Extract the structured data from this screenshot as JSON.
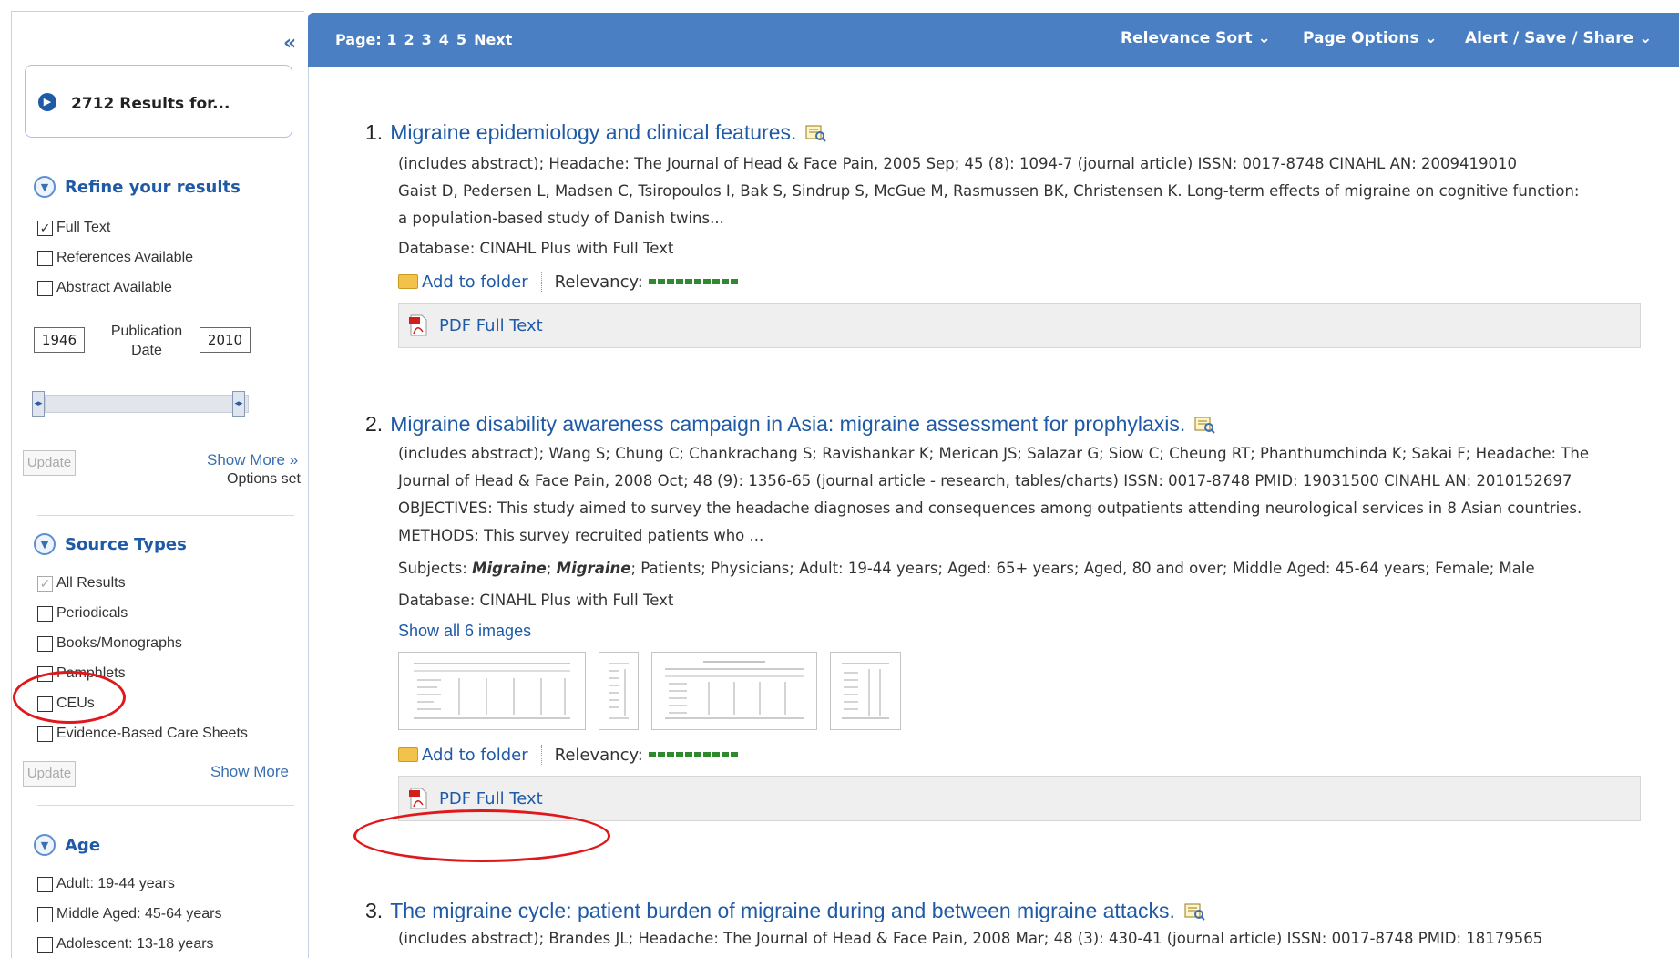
{
  "sidebar": {
    "collapse": "«",
    "results_count": "2712 Results for...",
    "refine_title": "Refine your results",
    "refine_options": [
      {
        "label": "Full Text",
        "checked": true
      },
      {
        "label": "References Available",
        "checked": false
      },
      {
        "label": "Abstract Available",
        "checked": false
      }
    ],
    "pub_from": "1946",
    "pub_to": "2010",
    "pub_label": "Publication Date",
    "update_label": "Update",
    "show_more_1": "Show More »",
    "options_set": "Options set",
    "source_types_title": "Source Types",
    "source_types": [
      {
        "label": "All Results",
        "checked": true,
        "disabled": true
      },
      {
        "label": "Periodicals",
        "checked": false
      },
      {
        "label": "Books/Monographs",
        "checked": false
      },
      {
        "label": "Pamphlets",
        "checked": false
      },
      {
        "label": "CEUs",
        "checked": false
      },
      {
        "label": "Evidence-Based Care Sheets",
        "checked": false
      }
    ],
    "show_more_2": "Show More",
    "age_title": "Age",
    "age_options": [
      {
        "label": "Adult: 19-44 years",
        "checked": false
      },
      {
        "label": "Middle Aged: 45-64 years",
        "checked": false
      },
      {
        "label": "Adolescent: 13-18 years",
        "checked": false
      }
    ]
  },
  "topbar": {
    "page_label": "Page: 1",
    "pages": [
      "2",
      "3",
      "4",
      "5"
    ],
    "next": "Next",
    "relevance_sort": "Relevance Sort ⌄",
    "page_options": "Page Options ⌄",
    "alert_save_share": "Alert / Save / Share ⌄"
  },
  "results": [
    {
      "num": "1.",
      "title": "Migraine epidemiology and clinical features.",
      "meta_line1": "(includes abstract); Headache: The Journal of Head & Face Pain, 2005 Sep; 45 (8): 1094-7 (journal article) ISSN: 0017-8748 CINAHL AN: 2009419010",
      "meta_line2": "Gaist D, Pedersen L, Madsen C, Tsiropoulos I, Bak S, Sindrup S, McGue M, Rasmussen BK, Christensen K. Long-term effects of migraine on cognitive function:",
      "meta_line3": "a population-based study of Danish twins...",
      "database": "Database: CINAHL Plus with Full Text",
      "add_to_folder": "Add to folder",
      "relevancy": "Relevancy:",
      "pdf": "PDF Full Text"
    },
    {
      "num": "2.",
      "title": "Migraine disability awareness campaign in Asia: migraine assessment for prophylaxis.",
      "meta_line1": "(includes abstract); Wang S; Chung C; Chankrachang S; Ravishankar K; Merican JS; Salazar G; Siow C; Cheung RT; Phanthumchinda K; Sakai F; Headache: The",
      "meta_line2": "Journal of Head & Face Pain, 2008 Oct; 48 (9): 1356-65 (journal article - research, tables/charts) ISSN: 0017-8748 PMID: 19031500 CINAHL AN: 2010152697",
      "meta_line3": "OBJECTIVES: This study aimed to survey the headache diagnoses and consequences among outpatients attending neurological services in 8 Asian countries.",
      "meta_line4": "METHODS: This survey recruited patients who ...",
      "subjects_label": "Subjects:",
      "subject_bold_1": "Migraine",
      "subject_bold_2": "Migraine",
      "subjects_rest": "; Patients; Physicians; Adult: 19-44 years; Aged: 65+ years; Aged, 80 and over; Middle Aged: 45-64 years; Female; Male",
      "database": "Database: CINAHL Plus with Full Text",
      "show_images": "Show all 6 images",
      "add_to_folder": "Add to folder",
      "relevancy": "Relevancy:",
      "pdf": "PDF Full Text"
    },
    {
      "num": "3.",
      "title": "The migraine cycle: patient burden of migraine during and between migraine attacks.",
      "meta_line1": "(includes abstract); Brandes JL; Headache: The Journal of Head & Face Pain, 2008 Mar; 48 (3): 430-41 (journal article) ISSN: 0017-8748 PMID: 18179565"
    }
  ],
  "colors": {
    "accent": "#4a7fc3",
    "link": "#1f5aa6",
    "annotation_red": "#e0181c",
    "relevancy_green": "#2f8a2f"
  }
}
